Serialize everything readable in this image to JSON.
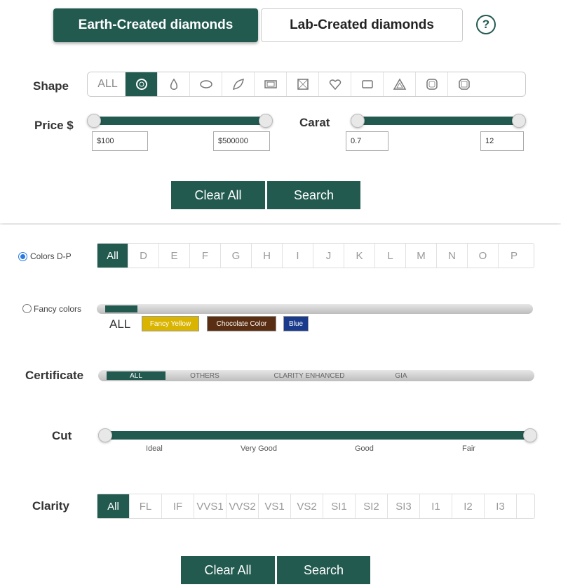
{
  "tabs": {
    "earth": "Earth-Created diamonds",
    "lab": "Lab-Created diamonds",
    "help": "?"
  },
  "shape": {
    "label": "Shape",
    "all": "ALL",
    "items": [
      "round-icon",
      "pear-icon",
      "oval-icon",
      "marquise-icon",
      "emerald-icon",
      "princess-icon",
      "heart-icon",
      "radiant-icon",
      "triangle-icon",
      "cushion-icon",
      "asscher-icon"
    ]
  },
  "price": {
    "label": "Price $",
    "min": "$100",
    "max": "$500000"
  },
  "carat": {
    "label": "Carat",
    "min": "0.7",
    "max": "12"
  },
  "buttons": {
    "clear": "Clear All",
    "search": "Search"
  },
  "colors": {
    "label": "Colors D-P",
    "items": [
      "All",
      "D",
      "E",
      "F",
      "G",
      "H",
      "I",
      "J",
      "K",
      "L",
      "M",
      "N",
      "O",
      "P"
    ]
  },
  "fancy": {
    "label": "Fancy colors",
    "all": "ALL",
    "swatches": [
      {
        "label": "Fancy Yellow",
        "color": "#d9b400"
      },
      {
        "label": "Chocolate Color",
        "color": "#5a2e12"
      },
      {
        "label": "Blue",
        "color": "#1a3a8c"
      }
    ]
  },
  "certificate": {
    "label": "Certificate",
    "items": [
      "ALL",
      "OTHERS",
      "CLARITY ENHANCED",
      "GIA"
    ]
  },
  "cut": {
    "label": "Cut",
    "items": [
      "Ideal",
      "Very Good",
      "Good",
      "Fair"
    ]
  },
  "clarity": {
    "label": "Clarity",
    "items": [
      "All",
      "FL",
      "IF",
      "VVS1",
      "VVS2",
      "VS1",
      "VS2",
      "SI1",
      "SI2",
      "SI3",
      "I1",
      "I2",
      "I3"
    ]
  },
  "colors_theme": {
    "accent": "#225a50"
  }
}
